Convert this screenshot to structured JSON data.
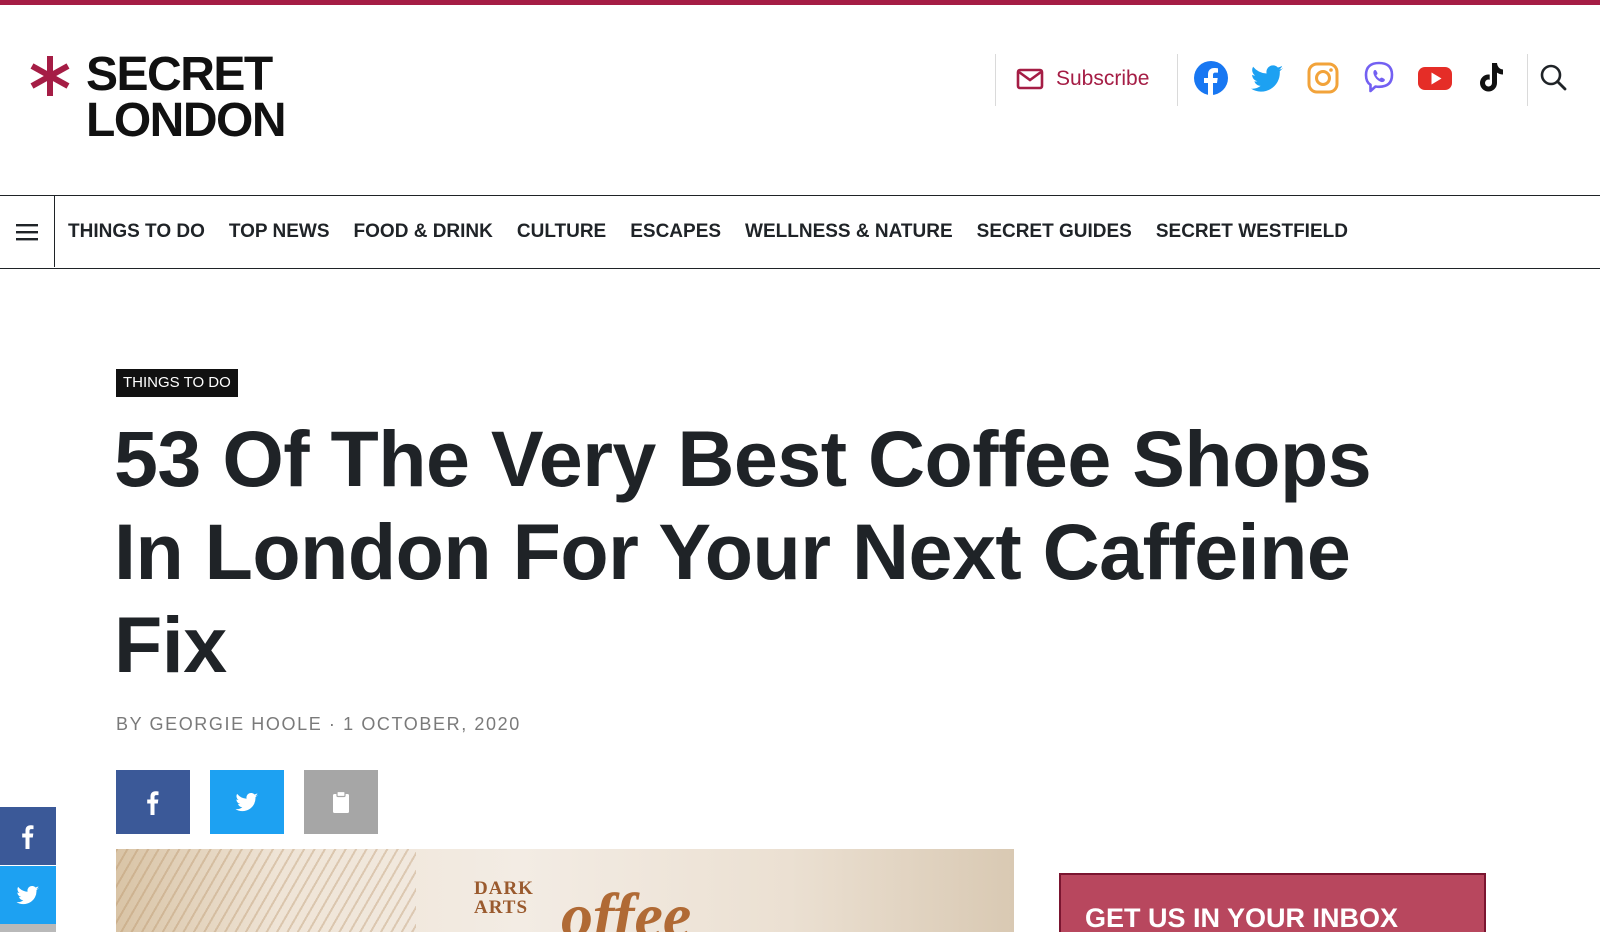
{
  "brand": {
    "logo_line1": "SECRET",
    "logo_line2": "LONDON",
    "accent_color": "#a51d45"
  },
  "header": {
    "subscribe_label": "Subscribe",
    "social_icons": [
      "facebook-icon",
      "twitter-icon",
      "instagram-icon",
      "viber-icon",
      "youtube-icon",
      "tiktok-icon"
    ],
    "search_icon": "search-icon"
  },
  "nav": {
    "menu_icon": "hamburger-menu-icon",
    "items": [
      {
        "label": "THINGS TO DO"
      },
      {
        "label": "TOP NEWS"
      },
      {
        "label": "FOOD & DRINK"
      },
      {
        "label": "CULTURE"
      },
      {
        "label": "ESCAPES"
      },
      {
        "label": "WELLNESS & NATURE"
      },
      {
        "label": "SECRET GUIDES"
      },
      {
        "label": "SECRET WESTFIELD"
      }
    ]
  },
  "article": {
    "category": "THINGS TO DO",
    "headline": "53 Of The Very Best Coffee Shops In London For Your Next Caffeine Fix",
    "byline": "BY GEORGIE HOOLE · 1 OCTOBER, 2020",
    "share_buttons": [
      {
        "icon": "facebook-icon",
        "color": "#3b5998"
      },
      {
        "icon": "twitter-icon",
        "color": "#1da1f2"
      },
      {
        "icon": "clipboard-icon",
        "color": "#a6a6a6"
      }
    ],
    "hero": {
      "sign_line1": "DARK",
      "sign_line2": "ARTS",
      "script_text": "offee"
    }
  },
  "sidebar": {
    "newsletter_title": "GET US IN YOUR INBOX"
  },
  "floating_share": {
    "icons": [
      "facebook-icon",
      "twitter-icon"
    ]
  }
}
